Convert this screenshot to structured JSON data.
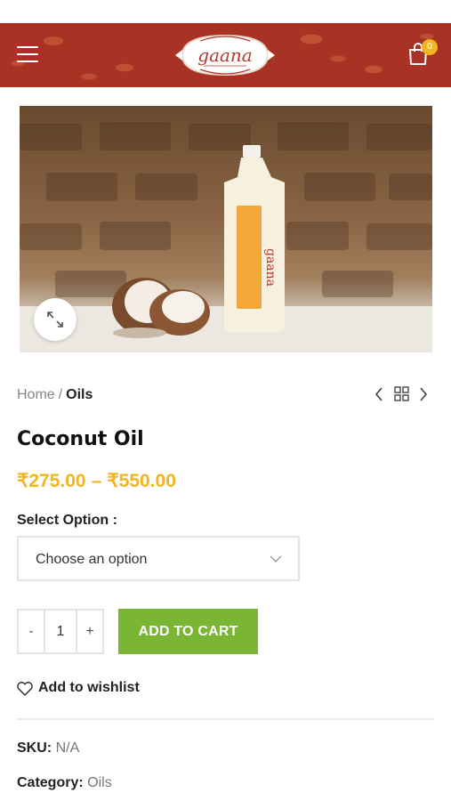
{
  "header": {
    "brand": "gaana",
    "cart_count": "0"
  },
  "breadcrumb": {
    "home": "Home",
    "separator": "/",
    "current": "Oils"
  },
  "product": {
    "title": "Coconut Oil",
    "price_min": "₹275.00",
    "price_separator": "–",
    "price_max": "₹550.00",
    "option_label": "Select Option :",
    "option_placeholder": "Choose an option",
    "quantity": "1",
    "qty_minus": "-",
    "qty_plus": "+",
    "add_to_cart": "ADD TO CART",
    "wishlist": "Add to wishlist"
  },
  "meta": {
    "sku_label": "SKU:",
    "sku_value": "N/A",
    "category_label": "Category:",
    "category_value": "Oils"
  },
  "colors": {
    "header_bg": "#a83223",
    "price": "#f2b51d",
    "add_to_cart_bg": "#7ab534",
    "badge": "#f2b51d"
  },
  "icons": [
    "hamburger-menu-icon",
    "shopping-bag-icon",
    "expand-icon",
    "chevron-left-icon",
    "grid-icon",
    "chevron-right-icon",
    "chevron-down-icon",
    "heart-icon"
  ]
}
